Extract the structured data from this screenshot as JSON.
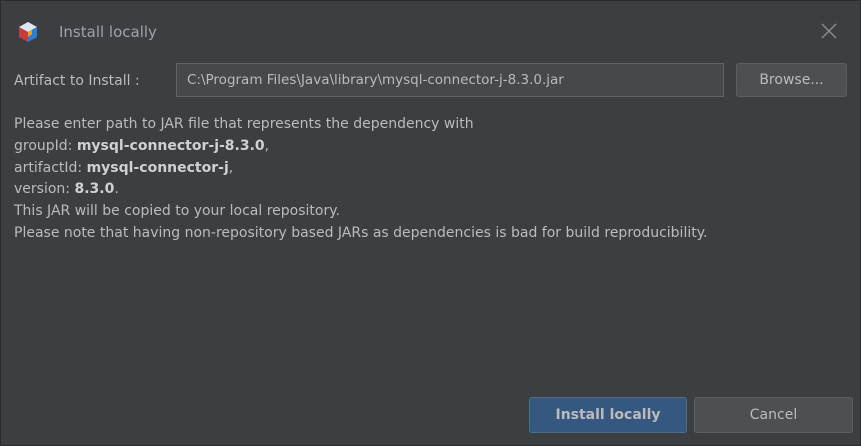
{
  "window": {
    "title": "Install locally",
    "icon": "netbeans-cube-icon",
    "close_icon": "close-icon"
  },
  "artifact": {
    "label": "Artifact to Install :",
    "path_value": "C:\\Program Files\\Java\\library\\mysql-connector-j-8.3.0.jar",
    "browse_label": "Browse..."
  },
  "message": {
    "intro": "Please enter path to JAR file that represents the dependency with",
    "group_label": "groupId: ",
    "group_value": "mysql-connector-j-8.3.0",
    "group_suffix": ",",
    "artifact_label": "artifactId: ",
    "artifact_value": "mysql-connector-j",
    "artifact_suffix": ",",
    "version_label": "version: ",
    "version_value": "8.3.0",
    "version_suffix": ".",
    "copy_note": "This JAR will be copied to your local repository.",
    "warning": "Please note that having non-repository based JARs as dependencies is bad for build reproducibility."
  },
  "buttons": {
    "install_label": "Install locally",
    "cancel_label": "Cancel"
  },
  "colors": {
    "background": "#3c3f41",
    "text": "#bbbbbb",
    "primary_button": "#365880",
    "secondary_button": "#4c5052"
  }
}
